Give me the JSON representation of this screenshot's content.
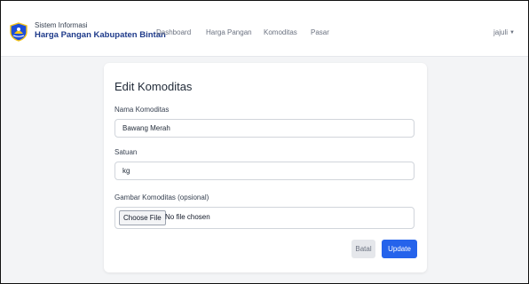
{
  "header": {
    "subtitle": "Sistem Informasi",
    "title": "Harga Pangan Kabupaten Bintan",
    "nav": [
      "Dashboard",
      "Harga Pangan",
      "Komoditas",
      "Pasar"
    ],
    "user": "jajuli",
    "logo_icon": "bintan-regency-emblem-icon",
    "caret_icon": "chevron-down-icon",
    "colors": {
      "brand": "#1e3a8a",
      "logo_blue": "#1d4ed8",
      "logo_gold": "#f5c518"
    }
  },
  "form": {
    "heading": "Edit Komoditas",
    "name_label": "Nama Komoditas",
    "name_value": "Bawang Merah",
    "unit_label": "Satuan",
    "unit_value": "kg",
    "image_label": "Gambar Komoditas (opsional)",
    "choose_file": "Choose File",
    "no_file": "No file chosen",
    "cancel": "Batal",
    "submit": "Update",
    "colors": {
      "primary": "#2563eb",
      "secondary": "#e5e7eb"
    }
  }
}
